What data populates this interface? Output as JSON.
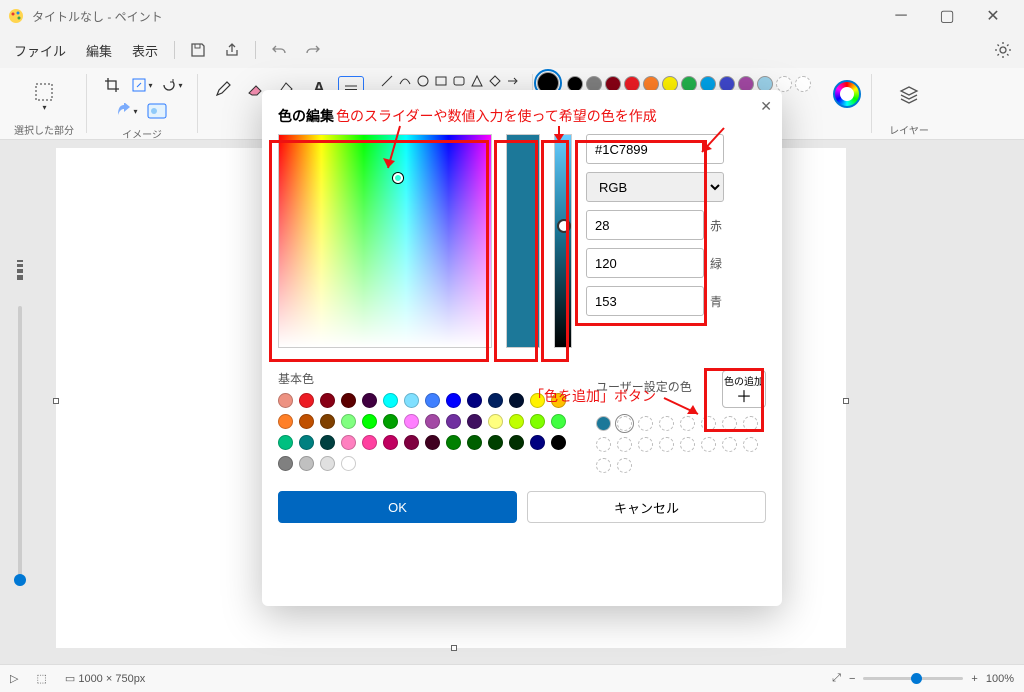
{
  "window": {
    "title": "タイトルなし - ペイント"
  },
  "menubar": {
    "file": "ファイル",
    "edit": "編集",
    "view": "表示"
  },
  "ribbon": {
    "selection_label": "選択した部分",
    "image_label": "イメージ",
    "layers_label": "レイヤー"
  },
  "palette_row1": [
    "#000000",
    "#7f7f7f",
    "#880015",
    "#ed1c24",
    "#ff7f27",
    "#fff200",
    "#22b14c",
    "#00a2e8",
    "#3f48cc",
    "#a349a4"
  ],
  "palette_row2": [
    "#9ad0e8",
    "#ffffff",
    "#ffffff",
    "#ffffff",
    "#ffffff",
    "#ffffff",
    "#ffffff",
    "#ffffff",
    "#ffffff",
    "#ffffff"
  ],
  "dialog": {
    "title": "色の編集",
    "hex": "#1C7899",
    "mode": "RGB",
    "r": "28",
    "g": "120",
    "b": "153",
    "r_label": "赤",
    "g_label": "緑",
    "b_label": "青",
    "basic_label": "基本色",
    "user_label": "ユーザー設定の色",
    "add_label": "色の追加",
    "ok": "OK",
    "cancel": "キャンセル",
    "basic_colors": [
      "#ed9282",
      "#ed1c24",
      "#880015",
      "#5c0000",
      "#400040",
      "#00ffff",
      "#80e0ff",
      "#4080ff",
      "#0000ff",
      "#000080",
      "#002060",
      "#001030",
      "#fff200",
      "#ffc000",
      "#ff7f27",
      "#c05000",
      "#804000",
      "#80ff80",
      "#00ff00",
      "#00a000",
      "#ff80ff",
      "#a349a4",
      "#7030a0",
      "#401060",
      "#ffff80",
      "#c0ff00",
      "#80ff00",
      "#40ff40",
      "#00c080",
      "#008080",
      "#004040",
      "#ff80c0",
      "#ff40a0",
      "#c00060",
      "#800040",
      "#400020",
      "#008000",
      "#006000",
      "#004000",
      "#003000",
      "#000080",
      "#000000",
      "#808080",
      "#c0c0c0",
      "#e0e0e0",
      "#ffffff"
    ],
    "user_colors": [
      "#1c7899",
      "",
      "",
      "",
      "",
      "",
      "",
      "",
      "",
      "",
      "",
      "",
      "",
      "",
      "",
      "",
      "",
      ""
    ]
  },
  "annotations": {
    "slider_text": "色のスライダーや数値入力を使って希望の色を作成",
    "add_button_text": "「色を追加」ボタン"
  },
  "status": {
    "canvas_size": "1000 × 750px",
    "zoom": "100%"
  }
}
